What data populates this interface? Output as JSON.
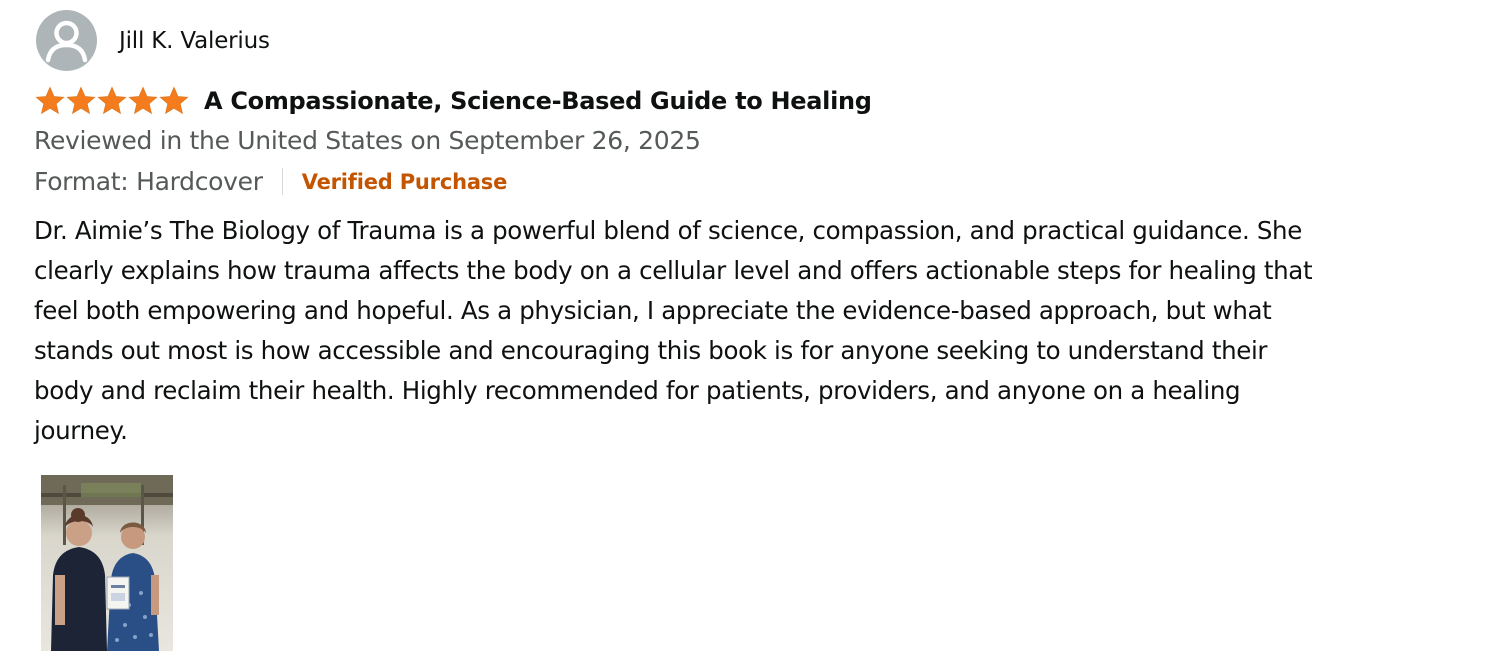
{
  "reviewer": {
    "name": "Jill K. Valerius",
    "avatar_icon": "default-user-icon"
  },
  "review": {
    "rating": 5,
    "rating_max": 5,
    "star_color": "#f47c1c",
    "title": "A Compassionate, Science-Based Guide to Healing",
    "date_text": "Reviewed in the United States on September 26, 2025",
    "format": "Format: Hardcover",
    "verified_label": "Verified Purchase",
    "verified_color": "#c45500",
    "body_lines": [
      "Dr. Aimie’s The Biology of Trauma is a powerful blend of science, compassion, and practical guidance. She",
      "clearly explains how trauma affects the body on a cellular level and offers actionable steps for healing that",
      "feel both empowering and hopeful. As a physician, I appreciate the evidence-based approach, but what",
      "stands out most is how accessible and encouraging this book is for anyone seeking to understand their",
      "body and reclaim their health. Highly recommended for patients, providers, and anyone on a healing",
      "journey."
    ],
    "image_icon": "review-photo"
  }
}
